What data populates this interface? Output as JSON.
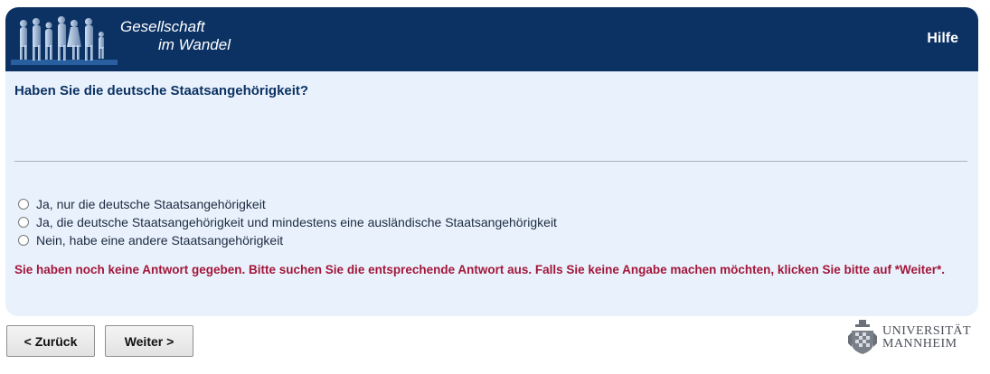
{
  "header": {
    "logo_line1": "Gesellschaft",
    "logo_line2": "im Wandel",
    "help_label": "Hilfe",
    "bg_color": "#0c3264"
  },
  "question": {
    "text": "Haben Sie die deutsche Staatsangehörigkeit?"
  },
  "options": [
    {
      "label": "Ja, nur die deutsche Staatsangehörigkeit",
      "selected": false
    },
    {
      "label": "Ja, die deutsche Staatsangehörigkeit und mindestens eine ausländische Staatsangehörigkeit",
      "selected": false
    },
    {
      "label": "Nein, habe eine andere Staatsangehörigkeit",
      "selected": false
    }
  ],
  "error_message": "Sie haben noch keine Antwort gegeben. Bitte suchen Sie die entsprechende Antwort aus. Falls Sie keine Angabe machen möchten, klicken Sie bitte auf *Weiter*.",
  "navigation": {
    "back_label": "< Zurück",
    "next_label": "Weiter >"
  },
  "footer": {
    "university_line1": "UNIVERSITÄT",
    "university_line2": "MANNHEIM"
  },
  "colors": {
    "panel_bg": "#e9f2fc",
    "error": "#a3163a",
    "question": "#0c3264"
  }
}
